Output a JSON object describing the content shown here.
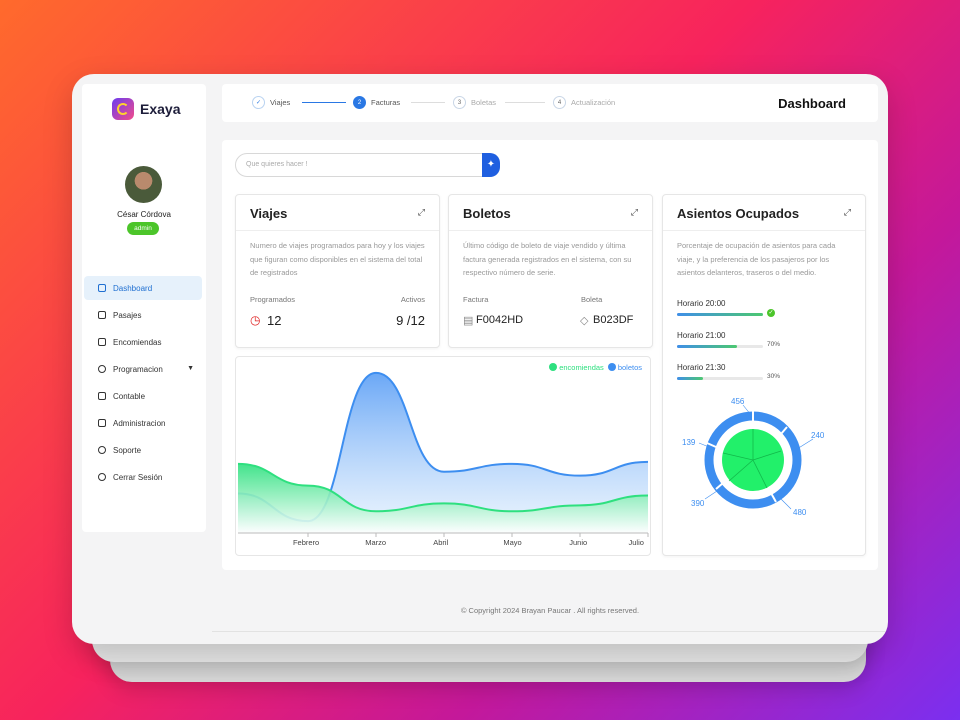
{
  "app": {
    "name": "Exaya"
  },
  "user": {
    "name": "César Córdova",
    "role": "admin"
  },
  "nav": [
    {
      "label": "Dashboard",
      "icon": "dashboard-icon"
    },
    {
      "label": "Pasajes",
      "icon": "ticket-icon"
    },
    {
      "label": "Encomiendas",
      "icon": "package-icon"
    },
    {
      "label": "Programacion",
      "icon": "clock-icon"
    },
    {
      "label": "Contable",
      "icon": "chart-line-icon"
    },
    {
      "label": "Administracion",
      "icon": "document-icon"
    },
    {
      "label": "Soporte",
      "icon": "help-icon"
    },
    {
      "label": "Cerrar Sesión",
      "icon": "logout-icon"
    }
  ],
  "steps": [
    {
      "num": "✓",
      "label": "Viajes"
    },
    {
      "num": "2",
      "label": "Facturas"
    },
    {
      "num": "3",
      "label": "Boletas"
    },
    {
      "num": "4",
      "label": "Actualización"
    }
  ],
  "page_title": "Dashboard",
  "search": {
    "placeholder": "Que quieres hacer !"
  },
  "viajes": {
    "title": "Viajes",
    "desc": "Numero de viajes programados para hoy y los viajes que figuran como disponibles en el sistema del total de registrados",
    "programados_label": "Programados",
    "programados_value": "12",
    "activos_label": "Activos",
    "activos_value": "9 /12"
  },
  "boletos": {
    "title": "Boletos",
    "desc": "Último código de boleto de viaje vendido y última factura generada registrados en el sistema, con su respectivo número de serie.",
    "factura_label": "Factura",
    "factura_value": "F0042HD",
    "boleta_label": "Boleta",
    "boleta_value": "B023DF"
  },
  "asientos": {
    "title": "Asientos Ocupados",
    "desc": "Porcentaje de ocupación de asientos para cada viaje, y la preferencia de los pasajeros por los asientos delanteros, traseros o del medio.",
    "horarios": [
      {
        "label": "Horario 20:00",
        "pct": 1.0,
        "pct_text": ""
      },
      {
        "label": "Horario 21:00",
        "pct": 0.7,
        "pct_text": "70%"
      },
      {
        "label": "Horario 21:30",
        "pct": 0.3,
        "pct_text": "30%"
      }
    ],
    "pie_labels": [
      "456",
      "240",
      "480",
      "390",
      "139"
    ]
  },
  "chart_data": {
    "type": "area",
    "categories": [
      "Febrero",
      "Marzo",
      "Abril",
      "Mayo",
      "Junio",
      "Julio"
    ],
    "series": [
      {
        "name": "encomiendas",
        "color": "#2ee07f",
        "values": [
          48,
          22,
          30,
          22,
          28,
          38
        ]
      },
      {
        "name": "boletos",
        "color": "#3d8ef0",
        "values": [
          12,
          162,
          62,
          70,
          58,
          72
        ]
      }
    ],
    "ylim": [
      0,
      170
    ]
  },
  "footer": {
    "text": "© Copyright 2024 Brayan Paucar . All rights reserved."
  }
}
